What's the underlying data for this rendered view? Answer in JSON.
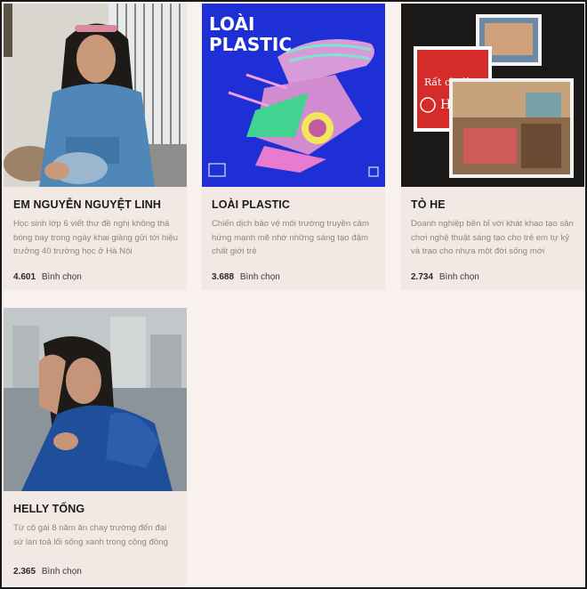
{
  "cards": [
    {
      "title": "EM NGUYỄN NGUYỆT LINH",
      "description": "Học sinh lớp 6 viết thư đề nghị không thả bóng bay trong ngày khai giảng gửi tới hiệu trưởng 40 trường học ở Hà Nội",
      "votes": "4.601",
      "vote_label": "Bình chọn"
    },
    {
      "title": "LOÀI PLASTIC",
      "description": "Chiến dịch bảo vệ môi trường truyền cảm hứng mạnh mẽ nhờ những sáng tạo đậm chất giới trẻ",
      "votes": "3.688",
      "vote_label": "Bình chọn",
      "poster_text": "LOÀI PLASTIC"
    },
    {
      "title": "TÒ HE",
      "description": "Doanh nghiệp bền bỉ với khát khao tạo sân chơi nghệ thuật sáng tạo cho trẻ em tự kỷ và trao cho nhựa một đời sống mới",
      "votes": "2.734",
      "vote_label": "Bình chọn",
      "card_text": "Rất chi là... Hí Hí"
    },
    {
      "title": "HELLY TỐNG",
      "description": "Từ cô gái 8 năm ăn chay trường đến đại sứ lan toả lối sống xanh trong cộng đồng",
      "votes": "2.365",
      "vote_label": "Bình chọn"
    }
  ],
  "colors": {
    "page_bg": "#f9f1ed",
    "card_bg": "#f2e9e4",
    "poster_blue": "#1f2fd6"
  }
}
